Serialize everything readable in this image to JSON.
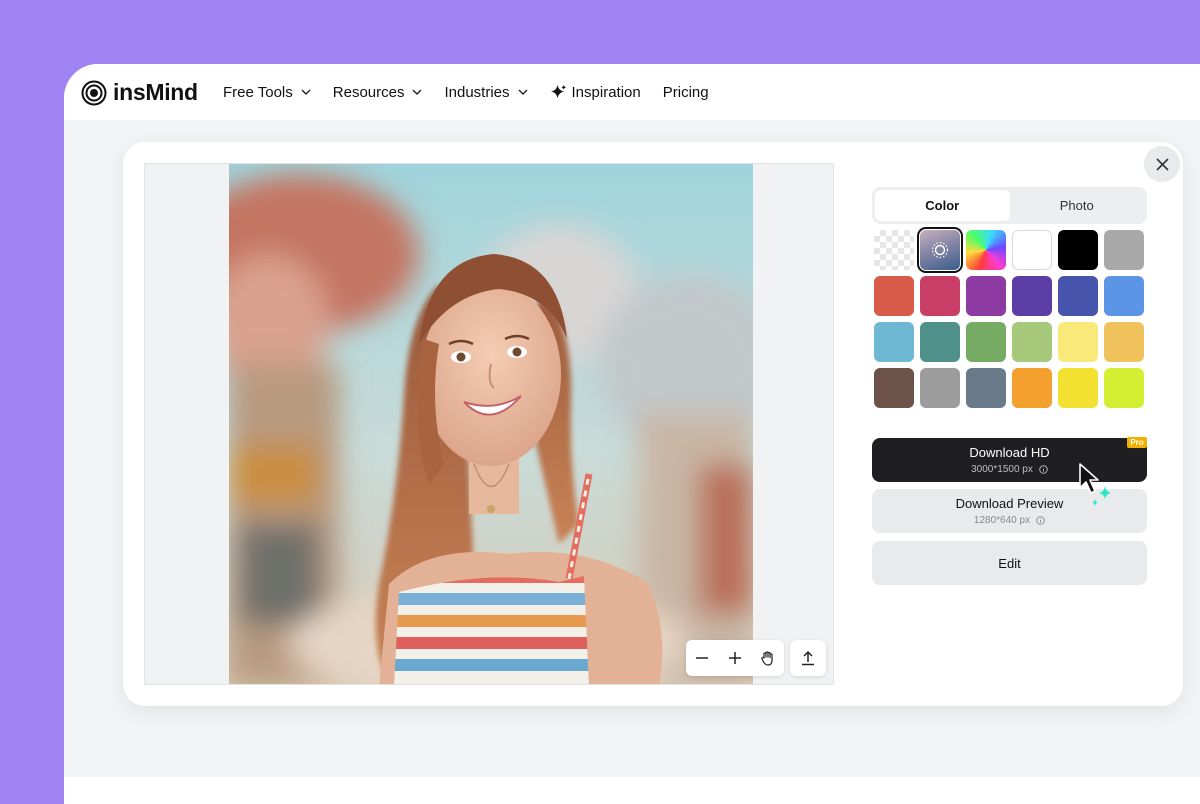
{
  "brand": {
    "name": "insMind"
  },
  "nav": {
    "items": [
      {
        "label": "Free Tools",
        "dropdown": true,
        "icon": "chevron-down-icon"
      },
      {
        "label": "Resources",
        "dropdown": true,
        "icon": "chevron-down-icon"
      },
      {
        "label": "Industries",
        "dropdown": true,
        "icon": "chevron-down-icon"
      },
      {
        "label": "Inspiration",
        "dropdown": false,
        "icon": "sparkle-icon"
      },
      {
        "label": "Pricing",
        "dropdown": false
      }
    ]
  },
  "panel": {
    "tabs": [
      {
        "label": "Color",
        "active": true
      },
      {
        "label": "Photo",
        "active": false
      }
    ],
    "swatches": [
      {
        "type": "transparent"
      },
      {
        "type": "blur",
        "selected": true
      },
      {
        "type": "rainbow"
      },
      {
        "type": "color",
        "color": "#ffffff"
      },
      {
        "type": "color",
        "color": "#000000"
      },
      {
        "type": "color",
        "color": "#a9a9a9"
      },
      {
        "type": "color",
        "color": "#d85a48"
      },
      {
        "type": "color",
        "color": "#c93e66"
      },
      {
        "type": "color",
        "color": "#8d3ba3"
      },
      {
        "type": "color",
        "color": "#5b3ea5"
      },
      {
        "type": "color",
        "color": "#4655ab"
      },
      {
        "type": "color",
        "color": "#5d95e6"
      },
      {
        "type": "color",
        "color": "#6fb8d3"
      },
      {
        "type": "color",
        "color": "#4f918a"
      },
      {
        "type": "color",
        "color": "#76ab64"
      },
      {
        "type": "color",
        "color": "#a6c87a"
      },
      {
        "type": "color",
        "color": "#f8e97a"
      },
      {
        "type": "color",
        "color": "#efc25c"
      },
      {
        "type": "color",
        "color": "#6c5249"
      },
      {
        "type": "color",
        "color": "#9c9c9c"
      },
      {
        "type": "color",
        "color": "#697b8b"
      },
      {
        "type": "color",
        "color": "#f3a02f"
      },
      {
        "type": "color",
        "color": "#f3e132"
      },
      {
        "type": "color",
        "color": "#d3ef31"
      }
    ],
    "download_hd": {
      "label": "Download HD",
      "size": "3000*1500 px",
      "badge": "Pro"
    },
    "download_preview": {
      "label": "Download Preview",
      "size": "1280*640 px"
    },
    "edit": {
      "label": "Edit"
    }
  },
  "toolbar": {
    "icons": [
      "zoom-out-icon",
      "zoom-in-icon",
      "hand-pan-icon",
      "upload-icon"
    ]
  }
}
